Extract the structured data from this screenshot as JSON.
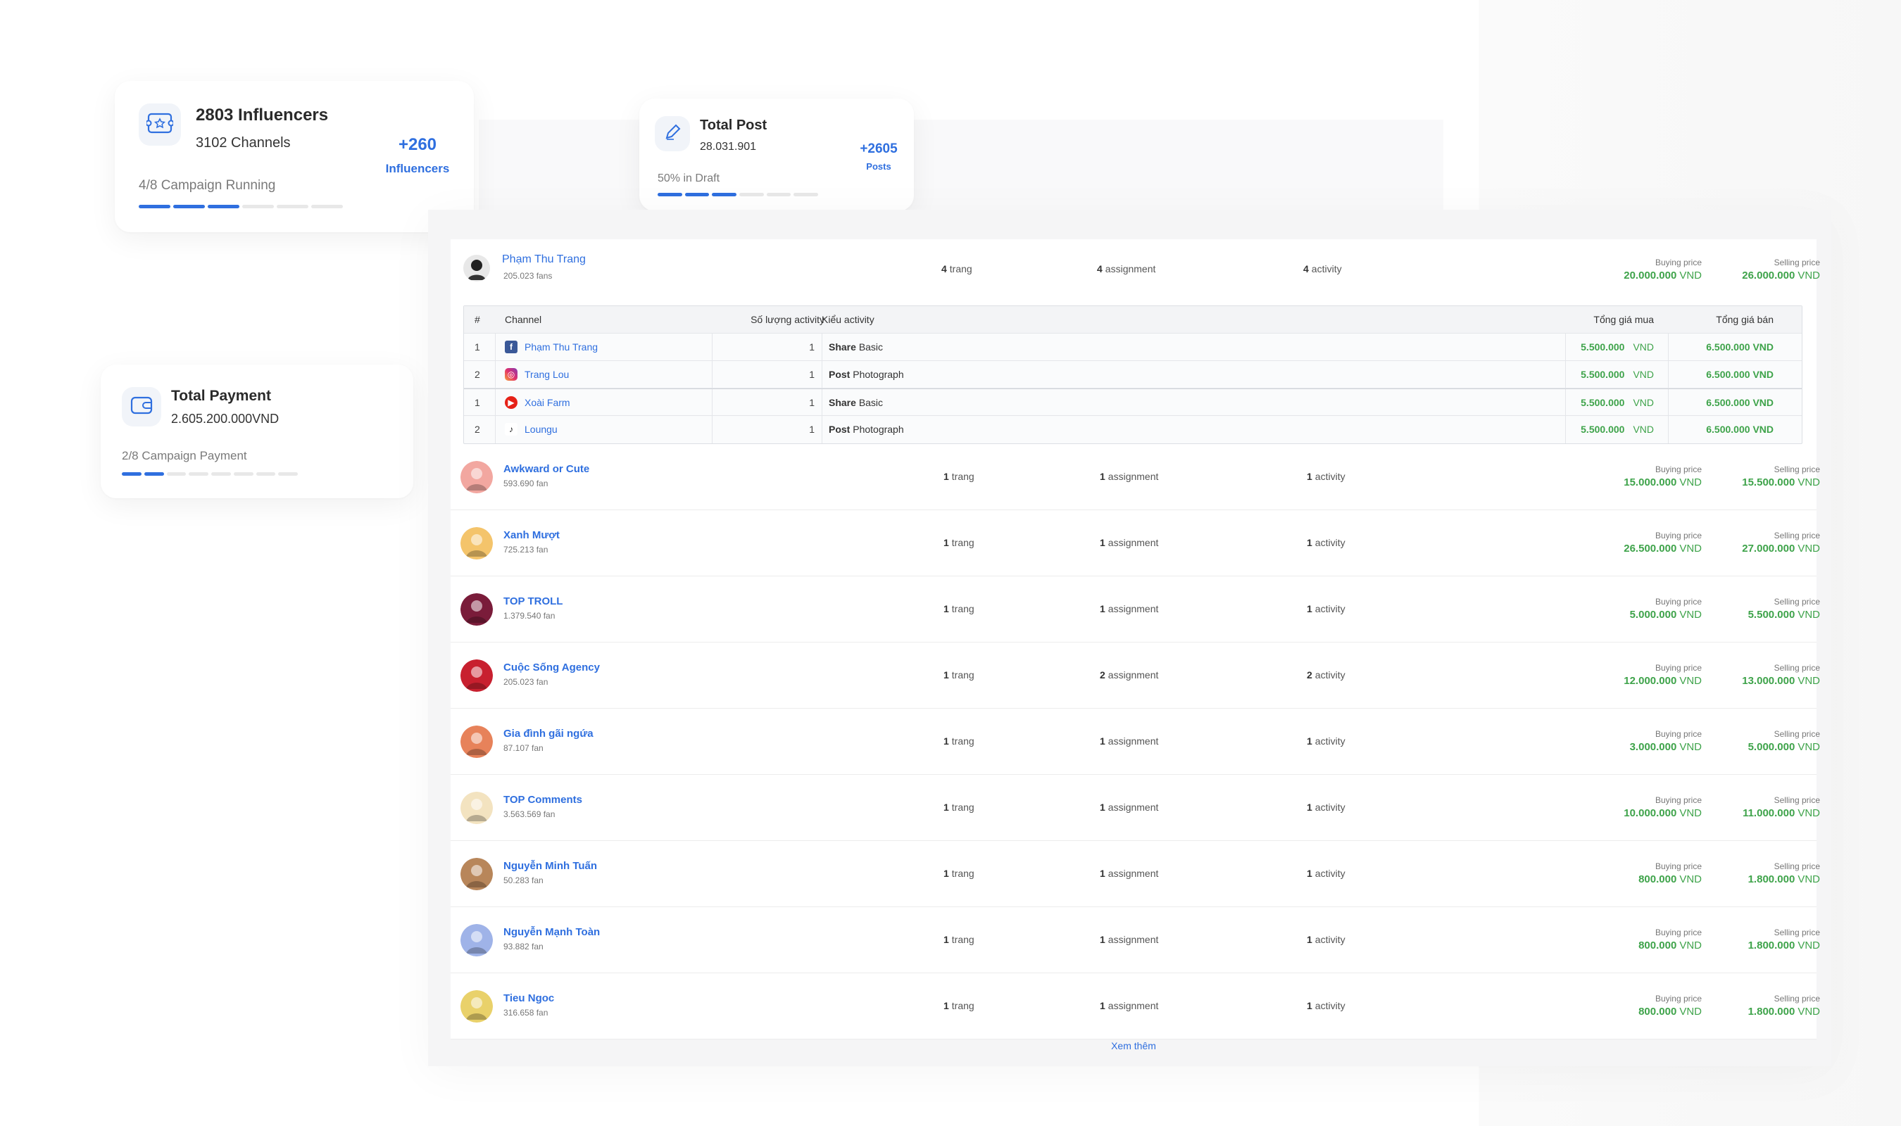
{
  "cards": {
    "influencers": {
      "title": "2803 Influencers",
      "channels": "3102 Channels",
      "delta_value": "+260",
      "delta_label": "Influencers",
      "footer": "4/8 Campaign Running",
      "progress": 0.5
    },
    "post": {
      "title": "Total Post",
      "count": "28.031.901",
      "delta_value": "+2605",
      "delta_label": "Posts",
      "footer": "50% in Draft",
      "progress": 0.5
    },
    "payment": {
      "title": "Total Payment",
      "amount": "2.605.200.000VND",
      "footer": "2/8 Campaign Payment",
      "progress": 0.25
    }
  },
  "icons": {
    "influencers": "star-ticket-icon",
    "post": "pencil-icon",
    "payment": "wallet-icon"
  },
  "labels": {
    "buying": "Buying price",
    "selling": "Selling price",
    "vnd": "VND",
    "more": "Xem thêm"
  },
  "colors": {
    "accent": "#2f6fdf",
    "price_green": "#3ea34a"
  },
  "expanded": {
    "name": "Phạm Thu Trang",
    "fans": "205.023 fans",
    "trang_n": "4",
    "trang_l": "trang",
    "assign_n": "4",
    "assign_l": "assignment",
    "act_n": "4",
    "act_l": "activity",
    "buy": "20.000.000",
    "sell": "26.000.000",
    "headers": [
      "#",
      "Channel",
      "Số lượng activity",
      "Kiểu activity",
      "Tổng giá mua",
      "Tổng giá bán"
    ],
    "rows": [
      {
        "idx": "1",
        "icon": "facebook-icon",
        "channel": "Phạm Thu Trang",
        "qty": "1",
        "type_b": "Share",
        "type": "Basic",
        "buy": "5.500.000",
        "sell": "6.500.000"
      },
      {
        "idx": "2",
        "icon": "instagram-icon",
        "channel": "Trang Lou",
        "qty": "1",
        "type_b": "Post",
        "type": "Photograph",
        "buy": "5.500.000",
        "sell": "6.500.000"
      },
      {
        "idx": "1",
        "icon": "youtube-icon",
        "channel": "Xoài Farm",
        "qty": "1",
        "type_b": "Share",
        "type": "Basic",
        "buy": "5.500.000",
        "sell": "6.500.000"
      },
      {
        "idx": "2",
        "icon": "tiktok-icon",
        "channel": "Loungu",
        "qty": "1",
        "type_b": "Post",
        "type": "Photograph",
        "buy": "5.500.000",
        "sell": "6.500.000"
      }
    ]
  },
  "influencers": [
    {
      "name": "Awkward or Cute",
      "fans": "593.690 fan",
      "trang": "1",
      "assign": "1",
      "act": "1",
      "buy": "15.000.000",
      "sell": "15.500.000",
      "avatar": "#f2a7a0"
    },
    {
      "name": "Xanh Mượt",
      "fans": "725.213 fan",
      "trang": "1",
      "assign": "1",
      "act": "1",
      "buy": "26.500.000",
      "sell": "27.000.000",
      "avatar": "#f4c46b"
    },
    {
      "name": "TOP TROLL",
      "fans": "1.379.540 fan",
      "trang": "1",
      "assign": "1",
      "act": "1",
      "buy": "5.000.000",
      "sell": "5.500.000",
      "avatar": "#7a1c3a"
    },
    {
      "name": "Cuộc Sống Agency",
      "fans": "205.023 fan",
      "trang": "1",
      "assign": "2",
      "act": "2",
      "buy": "12.000.000",
      "sell": "13.000.000",
      "avatar": "#c8202f"
    },
    {
      "name": "Gia đình gãi ngứa",
      "fans": "87.107 fan",
      "trang": "1",
      "assign": "1",
      "act": "1",
      "buy": "3.000.000",
      "sell": "5.000.000",
      "avatar": "#e7825a"
    },
    {
      "name": "TOP Comments",
      "fans": "3.563.569 fan",
      "trang": "1",
      "assign": "1",
      "act": "1",
      "buy": "10.000.000",
      "sell": "11.000.000",
      "avatar": "#f3e3c0"
    },
    {
      "name": "Nguyễn Minh Tuấn",
      "fans": "50.283 fan",
      "trang": "1",
      "assign": "1",
      "act": "1",
      "buy": "800.000",
      "sell": "1.800.000",
      "avatar": "#b8865a"
    },
    {
      "name": "Nguyễn Mạnh Toàn",
      "fans": "93.882 fan",
      "trang": "1",
      "assign": "1",
      "act": "1",
      "buy": "800.000",
      "sell": "1.800.000",
      "avatar": "#9fb3e8"
    },
    {
      "name": "Tieu Ngoc",
      "fans": "316.658 fan",
      "trang": "1",
      "assign": "1",
      "act": "1",
      "buy": "800.000",
      "sell": "1.800.000",
      "avatar": "#e9d16a"
    }
  ]
}
